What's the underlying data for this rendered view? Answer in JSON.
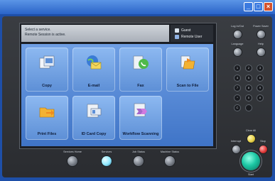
{
  "status": {
    "line1": "Select a service.",
    "line2": "Remote Session is active."
  },
  "user": {
    "guest": "Guest",
    "remote_user": "Remote User"
  },
  "tiles": [
    {
      "label": "Copy",
      "icon": "copy-icon"
    },
    {
      "label": "E-mail",
      "icon": "email-icon"
    },
    {
      "label": "Fax",
      "icon": "fax-icon"
    },
    {
      "label": "Scan to File",
      "icon": "scan-to-file-icon"
    },
    {
      "label": "Print Files",
      "icon": "print-files-icon"
    },
    {
      "label": "ID Card Copy",
      "icon": "id-card-copy-icon"
    },
    {
      "label": "Workflow Scanning",
      "icon": "workflow-scanning-icon"
    }
  ],
  "bottom_buttons": [
    "Services Home",
    "Services",
    "Job Status",
    "Machine Status"
  ],
  "right_panel": {
    "top_left": "Log In/Out",
    "top_right": "Power Saver",
    "mid_left": "Language",
    "mid_right": "Help",
    "clear_all": "Clear All",
    "interrupt": "Interrupt",
    "stop": "Stop",
    "start": "Start"
  },
  "keypad": [
    "1",
    "2",
    "3",
    "4",
    "5",
    "6",
    "7",
    "8",
    "9",
    "*",
    "0",
    "#",
    "C"
  ],
  "colors": {
    "titlebar": "#2a63c8",
    "tile": "#6f9fe4",
    "start": "#1cc7a4",
    "stop": "#e23b3b",
    "clear_all": "#e8d24a"
  }
}
